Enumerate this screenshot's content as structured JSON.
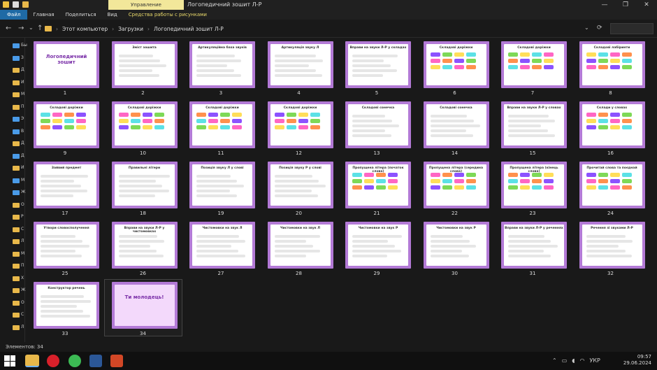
{
  "window": {
    "context_tab": "Управление",
    "title": "Логопедичний зошит Л-Р",
    "minimize": "—",
    "maximize": "❐",
    "close": "✕"
  },
  "ribbon": {
    "tabs": [
      "Файл",
      "Главная",
      "Поделиться",
      "Вид",
      "Средства работы с рисунками"
    ]
  },
  "address": {
    "back": "←",
    "forward": "→",
    "dropdown": "⌄",
    "up": "↑",
    "path": [
      "Этот компьютер",
      "Загрузки",
      "Логопедичний зошит Л-Р"
    ],
    "history_dropdown": "⌄",
    "refresh": "⟳"
  },
  "sidebar": {
    "items": [
      "Бы",
      "З",
      "Д",
      "И",
      "М",
      "П",
      "Э",
      "В",
      "Д",
      "Д",
      "И",
      "М",
      "Ж",
      "О",
      "Р",
      "С",
      "Л",
      "М",
      "П",
      "Х",
      "Ж",
      "О",
      "С",
      "Л"
    ]
  },
  "slides": [
    {
      "n": "1",
      "title": "Логопедичний зошит"
    },
    {
      "n": "2",
      "title": "Зміст зошита"
    },
    {
      "n": "3",
      "title": "Артикуляційна база звуків"
    },
    {
      "n": "4",
      "title": "Артикуляція звуку Л"
    },
    {
      "n": "5",
      "title": "Вправи на звуки Л-Р у складах"
    },
    {
      "n": "6",
      "title": "Складові доріжки"
    },
    {
      "n": "7",
      "title": "Складові доріжки"
    },
    {
      "n": "8",
      "title": "Складові лабіринти"
    },
    {
      "n": "9",
      "title": "Складові доріжки"
    },
    {
      "n": "10",
      "title": "Складові доріжки"
    },
    {
      "n": "11",
      "title": "Складові доріжки"
    },
    {
      "n": "12",
      "title": "Складові доріжки"
    },
    {
      "n": "13",
      "title": "Складові сонечка"
    },
    {
      "n": "14",
      "title": "Складові сонечка"
    },
    {
      "n": "15",
      "title": "Вправи на звуки Л-Р у словах"
    },
    {
      "n": "16",
      "title": "Склади у словах"
    },
    {
      "n": "17",
      "title": "Зайвий предмет"
    },
    {
      "n": "18",
      "title": "Правильні літери"
    },
    {
      "n": "19",
      "title": "Позиція звуку Л у слові"
    },
    {
      "n": "20",
      "title": "Позиція звуку Р у слові"
    },
    {
      "n": "21",
      "title": "Пропущена літера (початок слова)"
    },
    {
      "n": "22",
      "title": "Пропущена літера (середина слова)"
    },
    {
      "n": "23",
      "title": "Пропущена літера (кінець слова)"
    },
    {
      "n": "24",
      "title": "Прочитай слова та поєднай"
    },
    {
      "n": "25",
      "title": "Утвори словосполучення"
    },
    {
      "n": "26",
      "title": "Вправи на звуки Л-Р у чистомовках"
    },
    {
      "n": "27",
      "title": "Чистомовки на звук Л"
    },
    {
      "n": "28",
      "title": "Чистомовки на звук Л"
    },
    {
      "n": "29",
      "title": "Чистомовки на звук Р"
    },
    {
      "n": "30",
      "title": "Чистомовки на звук Р"
    },
    {
      "n": "31",
      "title": "Вправи на звуки Л-Р у реченнях"
    },
    {
      "n": "32",
      "title": "Речення зі звуками Л-Р"
    },
    {
      "n": "33",
      "title": "Конструктор речень"
    },
    {
      "n": "34",
      "title": "Ти молодець!"
    }
  ],
  "status": {
    "count": "Элементов: 34"
  },
  "taskbar": {
    "lang": "УКР",
    "time": "09:57",
    "date": "29.06.2024"
  },
  "colors": {
    "accent": "#b37ad6",
    "file_tab": "#1f6aa5",
    "context": "#f2e79a"
  }
}
